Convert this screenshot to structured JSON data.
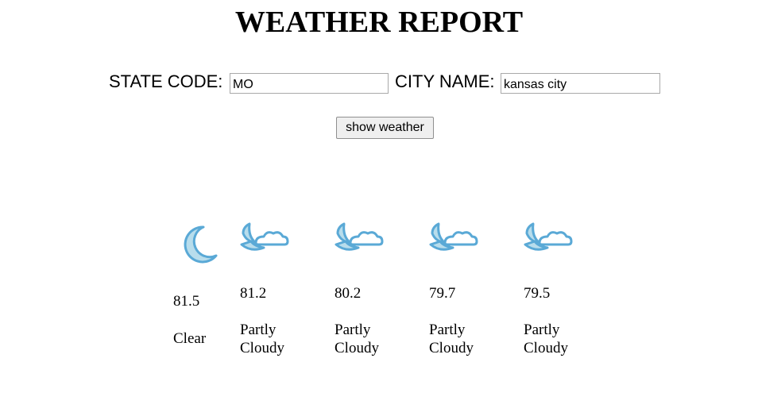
{
  "header": {
    "title": "WEATHER REPORT"
  },
  "form": {
    "state_label": "STATE CODE:",
    "state_value": "MO",
    "city_label": "CITY NAME:",
    "city_value": "kansas city",
    "submit_label": "show weather"
  },
  "forecast": [
    {
      "icon": "moon-icon",
      "temp": "81.5",
      "desc": "Clear"
    },
    {
      "icon": "moon-cloud-icon",
      "temp": "81.2",
      "desc": "Partly Cloudy"
    },
    {
      "icon": "moon-cloud-icon",
      "temp": "80.2",
      "desc": "Partly Cloudy"
    },
    {
      "icon": "moon-cloud-icon",
      "temp": "79.7",
      "desc": "Partly Cloudy"
    },
    {
      "icon": "moon-cloud-icon",
      "temp": "79.5",
      "desc": "Partly Cloudy"
    }
  ],
  "colors": {
    "icon_stroke": "#5aa9d6",
    "icon_fill": "#b8ddec",
    "cloud_fill": "#ffffff"
  }
}
